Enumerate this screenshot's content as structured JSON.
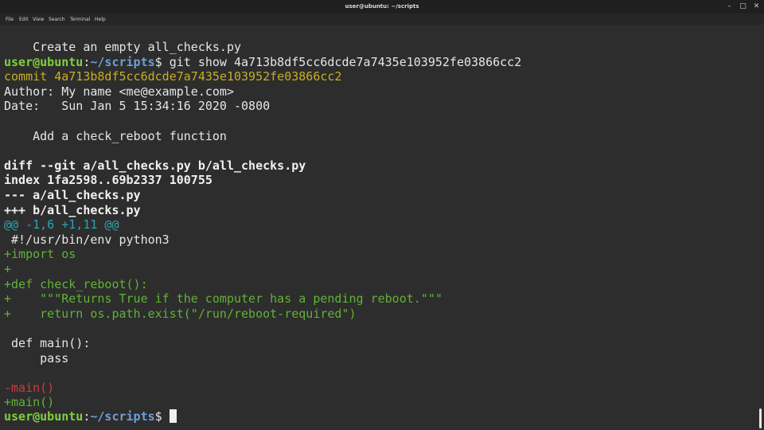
{
  "window": {
    "title": "user@ubuntu: ~/scripts",
    "min_glyph": "–",
    "max_glyph": "□",
    "close_glyph": "✕"
  },
  "menu": [
    "File",
    "Edit",
    "View",
    "Search",
    "Terminal",
    "Help"
  ],
  "terminal": {
    "prompt_user": "user@ubuntu",
    "prompt_sep": ":",
    "prompt_path": "~/scripts",
    "prompt_symbol": "$ ",
    "lines": {
      "l0": "    Create an empty all_checks.py",
      "l1_cmd": "git show 4a713b8df5cc6dcde7a7435e103952fe03866cc2",
      "l2": "commit 4a713b8df5cc6dcde7a7435e103952fe03866cc2",
      "l3": "Author: My name <me@example.com>",
      "l4": "Date:   Sun Jan 5 15:34:16 2020 -0800",
      "l6": "    Add a check_reboot function",
      "l8": "diff --git a/all_checks.py b/all_checks.py",
      "l9": "index 1fa2598..69b2337 100755",
      "l10": "--- a/all_checks.py",
      "l11": "+++ b/all_checks.py",
      "l12": "@@ -1,6 +1,11 @@",
      "l13": " #!/usr/bin/env python3",
      "l14": "+import os",
      "l15": "+",
      "l16": "+def check_reboot():",
      "l17": "+    \"\"\"Returns True if the computer has a pending reboot.\"\"\"",
      "l18": "+    return os.path.exist(\"/run/reboot-required\")",
      "l20": " def main():",
      "l21": "     pass",
      "l23": "-main()",
      "l24": "+main()"
    }
  },
  "colors": {
    "background": "#2d2d2d",
    "prompt_user": "#7fd13b",
    "prompt_path": "#6d9fd8",
    "commit_hash": "#c9ae22",
    "hunk_header": "#2aa5b4",
    "added": "#5fb236",
    "removed": "#d03a3a"
  }
}
